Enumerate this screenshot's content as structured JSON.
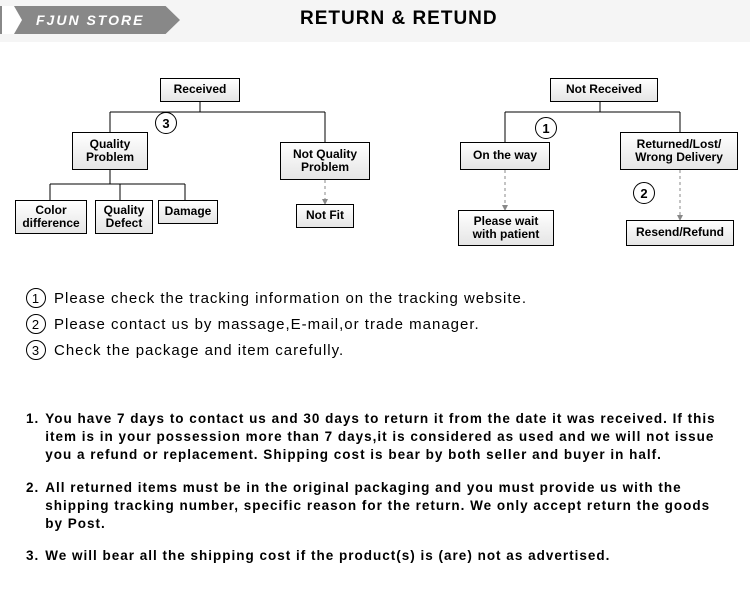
{
  "store_name": "FJUN STORE",
  "page_title": "RETURN & RETUND",
  "diagram": {
    "left_tree": {
      "root": "Received",
      "branch_marker": "3",
      "left": {
        "label": "Quality\nProblem",
        "children": [
          "Color\ndifference",
          "Quality\nDefect",
          "Damage"
        ]
      },
      "right": {
        "label": "Not Quality\nProblem",
        "children": [
          "Not Fit"
        ]
      }
    },
    "right_tree": {
      "root": "Not  Received",
      "branch_marker": "1",
      "left": {
        "label": "On the way",
        "children": [
          "Please wait\nwith patient"
        ]
      },
      "right": {
        "label": "Returned/Lost/\nWrong Delivery",
        "marker": "2",
        "children": [
          "Resend/Refund"
        ]
      }
    }
  },
  "legend": [
    {
      "num": "1",
      "text": "Please check the tracking information on the tracking website."
    },
    {
      "num": "2",
      "text": "Please contact us by  massage,E-mail,or trade manager."
    },
    {
      "num": "3",
      "text": "Check the package and item carefully."
    }
  ],
  "policy": [
    {
      "num": "1.",
      "text": "You have 7 days to contact us and 30 days to return it from the date it was received. If this item is in your possession more than 7 days,it is considered as used and we will not issue you a refund or replacement. Shipping cost is bear by both seller and buyer in half."
    },
    {
      "num": "2.",
      "text": "All returned items must be in the original packaging and you must provide us with the shipping tracking number, specific reason for the return. We only accept return the goods by Post."
    },
    {
      "num": "3.",
      "text": "We will bear all the shipping cost if the product(s) is (are) not as advertised."
    }
  ]
}
